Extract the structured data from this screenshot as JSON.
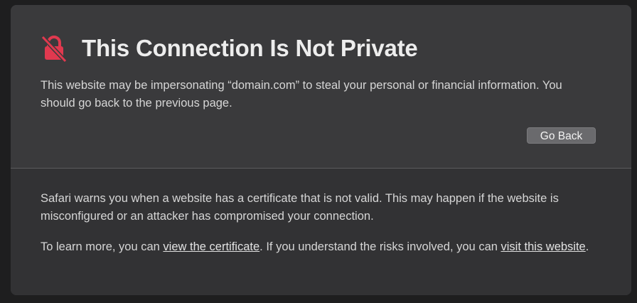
{
  "dialog": {
    "title": "This Connection Is Not Private",
    "icon": "lock-slash-icon",
    "icon_color": "#e0394f",
    "warning": "This website may be impersonating “domain.com” to steal your personal or financial information. You should go back to the previous page.",
    "go_back_label": "Go Back"
  },
  "details": {
    "paragraph1": "Safari warns you when a website has a certificate that is not valid. This may happen if the website is misconfigured or an attacker has compromised your connection.",
    "learn_more_prefix": "To learn more, you can ",
    "view_certificate_link": "view the certificate",
    "learn_more_middle": ". If you understand the risks involved, you can ",
    "visit_website_link": "visit this website",
    "learn_more_suffix": "."
  },
  "colors": {
    "background": "#1e1e1f",
    "panel": "#3a3a3c",
    "panel_bottom": "#323234",
    "accent_red": "#e0394f"
  }
}
